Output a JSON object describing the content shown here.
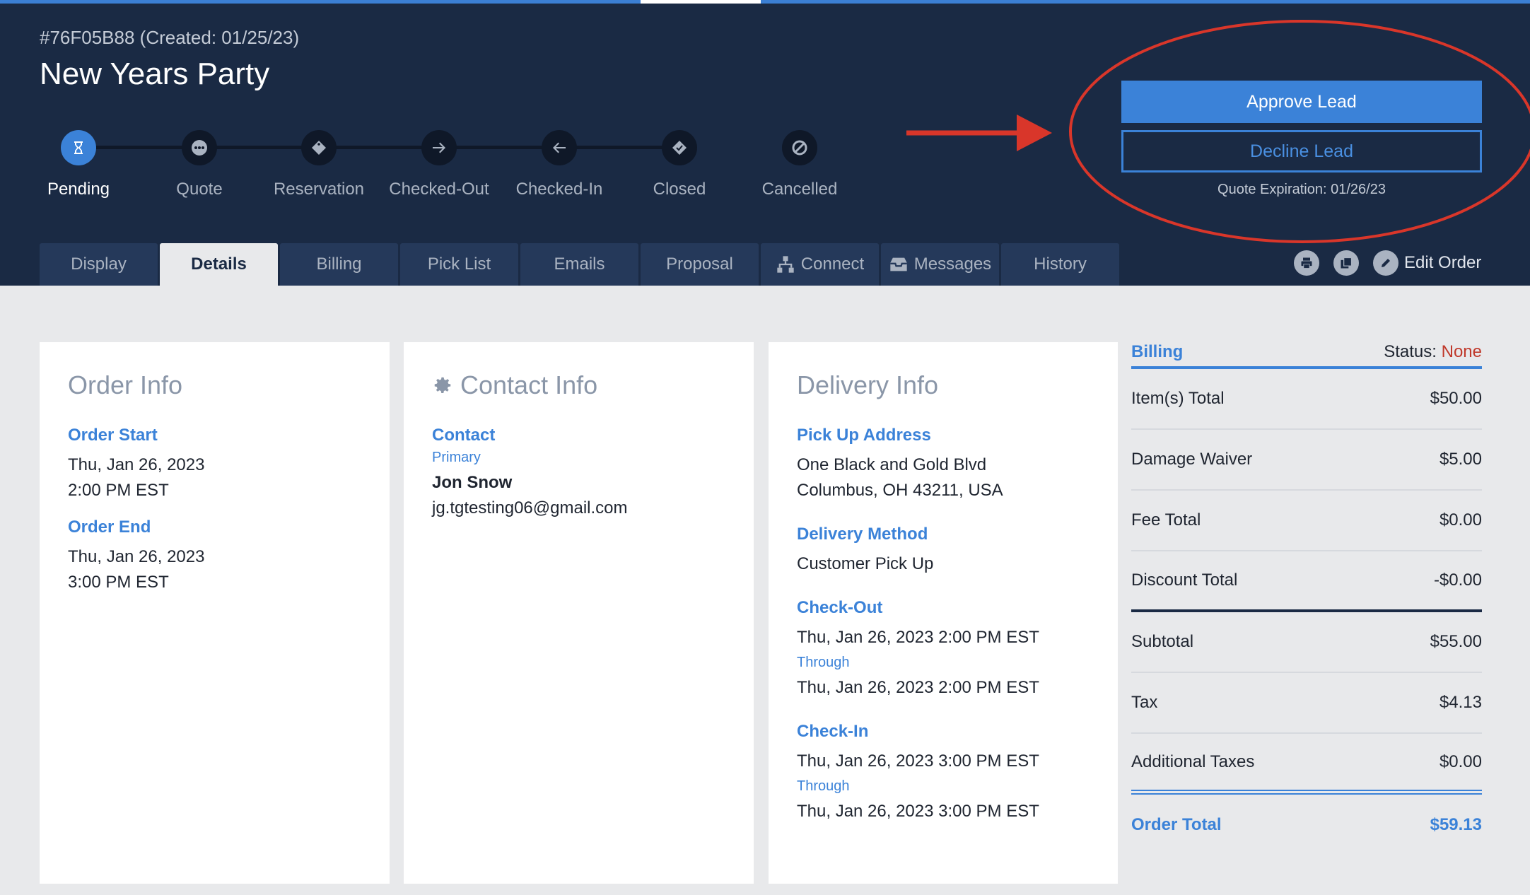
{
  "header": {
    "order_id": "#76F05B88 (Created: 01/25/23)",
    "title": "New Years Party"
  },
  "steps": [
    {
      "label": "Pending",
      "icon": "hourglass-icon"
    },
    {
      "label": "Quote",
      "icon": "ellipsis-icon"
    },
    {
      "label": "Reservation",
      "icon": "tag-icon"
    },
    {
      "label": "Checked-Out",
      "icon": "arrow-right-icon"
    },
    {
      "label": "Checked-In",
      "icon": "arrow-left-icon"
    },
    {
      "label": "Closed",
      "icon": "check-tag-icon"
    },
    {
      "label": "Cancelled",
      "icon": "ban-icon"
    }
  ],
  "lead": {
    "approve_label": "Approve Lead",
    "decline_label": "Decline Lead",
    "quote_expiration": "Quote Expiration: 01/26/23"
  },
  "tabs": [
    {
      "label": "Display"
    },
    {
      "label": "Details"
    },
    {
      "label": "Billing"
    },
    {
      "label": "Pick List"
    },
    {
      "label": "Emails"
    },
    {
      "label": "Proposal"
    },
    {
      "label": "Connect"
    },
    {
      "label": "Messages"
    },
    {
      "label": "History"
    }
  ],
  "toolbar": {
    "edit_order_label": "Edit Order"
  },
  "order_info": {
    "title": "Order Info",
    "start_label": "Order Start",
    "start_date": "Thu, Jan 26, 2023",
    "start_time": "2:00 PM EST",
    "end_label": "Order End",
    "end_date": "Thu, Jan 26, 2023",
    "end_time": "3:00 PM EST"
  },
  "contact_info": {
    "title": "Contact Info",
    "contact_label": "Contact",
    "primary_label": "Primary",
    "name": "Jon Snow",
    "email": "jg.tgtesting06@gmail.com"
  },
  "delivery_info": {
    "title": "Delivery Info",
    "pickup_label": "Pick Up Address",
    "address_line1": "One Black and Gold Blvd",
    "address_line2": "Columbus, OH 43211, USA",
    "method_label": "Delivery Method",
    "method": "Customer Pick Up",
    "checkout_label": "Check-Out",
    "checkout_from": "Thu, Jan 26, 2023 2:00 PM EST",
    "through_label": "Through",
    "checkout_to": "Thu, Jan 26, 2023 2:00 PM EST",
    "checkin_label": "Check-In",
    "checkin_from": "Thu, Jan 26, 2023 3:00 PM EST",
    "checkin_to": "Thu, Jan 26, 2023 3:00 PM EST"
  },
  "billing": {
    "title": "Billing",
    "status_label": "Status:",
    "status_value": "None",
    "rows": [
      {
        "label": "Item(s) Total",
        "value": "$50.00"
      },
      {
        "label": "Damage Waiver",
        "value": "$5.00"
      },
      {
        "label": "Fee Total",
        "value": "$0.00"
      },
      {
        "label": "Discount Total",
        "value": "-$0.00"
      },
      {
        "label": "Subtotal",
        "value": "$55.00"
      },
      {
        "label": "Tax",
        "value": "$4.13"
      },
      {
        "label": "Additional Taxes",
        "value": "$0.00"
      },
      {
        "label": "Order Total",
        "value": "$59.13"
      }
    ]
  },
  "colors": {
    "header_bg": "#1a2a44",
    "accent": "#3b82d8",
    "annotation_red": "#d9362a",
    "status_none": "#c0392b"
  }
}
